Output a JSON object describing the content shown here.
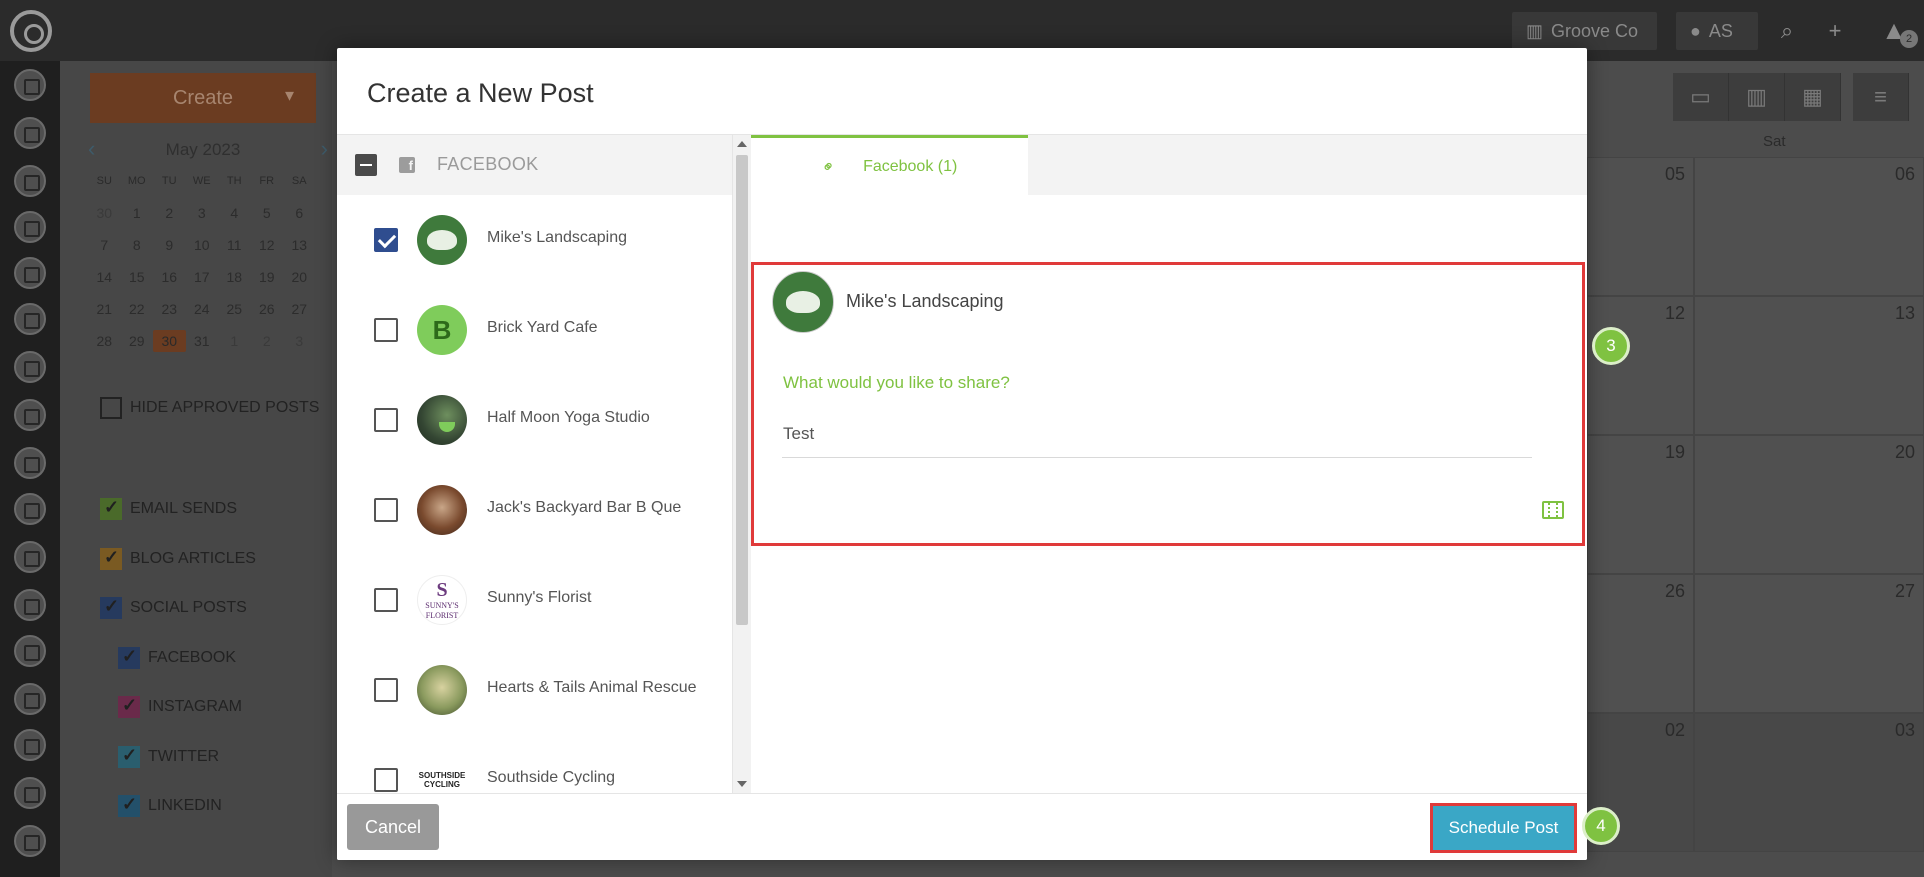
{
  "topbar": {
    "company": "Groove Co",
    "user_initials": "AS",
    "notification_count": "2"
  },
  "sidebar": {
    "create_label": "Create",
    "mini_calendar": {
      "month": "May 2023",
      "weekdays": [
        "SU",
        "MO",
        "TU",
        "WE",
        "TH",
        "FR",
        "SA"
      ],
      "weeks": [
        [
          "30",
          "1",
          "2",
          "3",
          "4",
          "5",
          "6"
        ],
        [
          "7",
          "8",
          "9",
          "10",
          "11",
          "12",
          "13"
        ],
        [
          "14",
          "15",
          "16",
          "17",
          "18",
          "19",
          "20"
        ],
        [
          "21",
          "22",
          "23",
          "24",
          "25",
          "26",
          "27"
        ],
        [
          "28",
          "29",
          "30",
          "31",
          "1",
          "2",
          "3"
        ]
      ],
      "today": "30"
    },
    "hide_approved_label": "HIDE APPROVED POSTS",
    "filters": {
      "email_sends": "EMAIL SENDS",
      "blog_articles": "BLOG ARTICLES",
      "social_posts": "SOCIAL POSTS",
      "facebook": "FACEBOOK",
      "instagram": "INSTAGRAM",
      "twitter": "TWITTER",
      "linkedin": "LINKEDIN"
    },
    "filter_colors": {
      "email": "#7fc241",
      "blog": "#e8a030",
      "social": "#2f4d8f",
      "facebook": "#2f4d8f",
      "instagram": "#c2307a",
      "twitter": "#3aa7c6",
      "linkedin": "#1f7bb6"
    }
  },
  "calendar": {
    "sat_header": "Sat",
    "days": {
      "fri_w1": "05",
      "sat_w1": "06",
      "fri_w2": "12",
      "sat_w2": "13",
      "fri_w3": "19",
      "sat_w3": "20",
      "fri_w4": "26",
      "sat_w4": "27",
      "fri_w5": "02",
      "sat_w5": "03"
    }
  },
  "modal": {
    "title": "Create a New Post",
    "network_header": "FACEBOOK",
    "accounts": [
      {
        "name": "Mike's Landscaping",
        "checked": true,
        "avatar": "tree-logo-icon"
      },
      {
        "name": "Brick Yard Cafe",
        "checked": false,
        "avatar": "letter-b-avatar",
        "avatar_text": "B"
      },
      {
        "name": "Half Moon Yoga Studio",
        "checked": false,
        "avatar": "yoga-studio-photo"
      },
      {
        "name": "Jack's Backyard Bar B Que",
        "checked": false,
        "avatar": "bbq-photo"
      },
      {
        "name": "Sunny's Florist",
        "checked": false,
        "avatar": "florist-logo"
      },
      {
        "name": "Hearts & Tails Animal Rescue",
        "checked": false,
        "avatar": "animal-rescue-photo"
      },
      {
        "name": "Southside Cycling",
        "checked": false,
        "avatar": "cycling-logo"
      }
    ],
    "florist_logo": {
      "initial": "S",
      "line1": "SUNNY'S",
      "line2": "FLORIST"
    },
    "cycling_logo": {
      "line1": "SOUTHSIDE",
      "line2": "CYCLING"
    },
    "tab_label": "Facebook (1)",
    "post": {
      "account_name": "Mike's Landscaping",
      "prompt": "What would you like to share?",
      "text": "Test"
    },
    "cancel_label": "Cancel",
    "schedule_label": "Schedule Post"
  },
  "annotations": {
    "step3": "3",
    "step4": "4"
  },
  "colors": {
    "accent_green": "#7fc241",
    "schedule_blue": "#3aa7c6",
    "highlight_red": "#e03a3a",
    "check_blue": "#2f4d8f"
  }
}
